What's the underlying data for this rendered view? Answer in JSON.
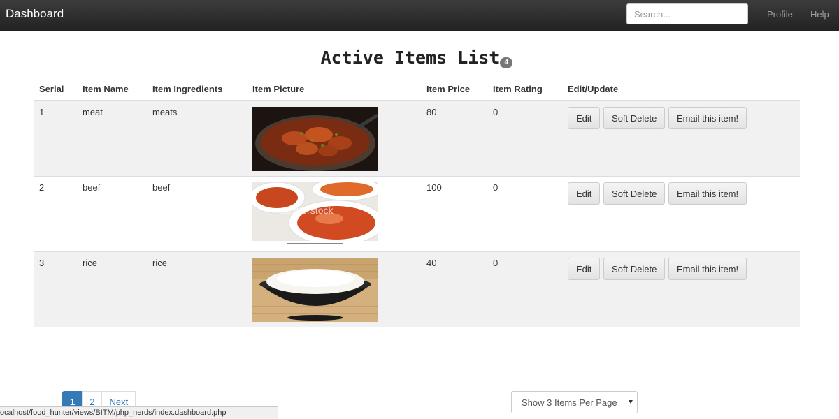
{
  "navbar": {
    "brand": "Dashboard",
    "search_placeholder": "Search...",
    "links": {
      "profile": "Profile",
      "help": "Help"
    }
  },
  "heading": {
    "title": "Active Items List",
    "badge": "4"
  },
  "table": {
    "headers": [
      "Serial",
      "Item Name",
      "Item Ingredients",
      "Item Picture",
      "Item Price",
      "Item Rating",
      "Edit/Update"
    ],
    "rows": [
      {
        "serial": "1",
        "name": "meat",
        "ingredients": "meats",
        "picture": "meat-curry-image",
        "price": "80",
        "rating": "0"
      },
      {
        "serial": "2",
        "name": "beef",
        "ingredients": "beef",
        "picture": "beef-kimchi-image",
        "price": "100",
        "rating": "0"
      },
      {
        "serial": "3",
        "name": "rice",
        "ingredients": "rice",
        "picture": "rice-bowl-image",
        "price": "40",
        "rating": "0"
      }
    ],
    "actions": {
      "edit": "Edit",
      "soft_delete": "Soft Delete",
      "email": "Email this item!"
    },
    "picture_watermark": "shutterstock"
  },
  "pagination": {
    "pages": [
      "1",
      "2"
    ],
    "current": "1",
    "next": "Next"
  },
  "per_page_select": {
    "selected": "Show 3 Items Per Page"
  },
  "status_bar": {
    "url": "ocalhost/food_hunter/views/BITM/php_nerds/index.dashboard.php"
  },
  "colors": {
    "navbar": "#222222",
    "accent": "#337ab7",
    "stripe": "#f1f1f1"
  }
}
